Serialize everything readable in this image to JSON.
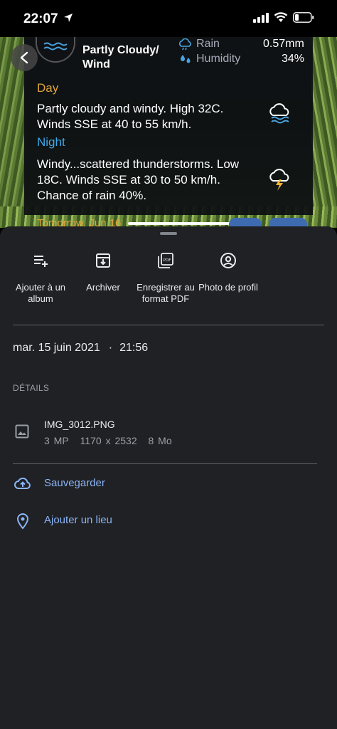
{
  "status_bar": {
    "time": "22:07"
  },
  "photo": {
    "condition": "Partly Cloudy/ Wind",
    "rain_label": "Rain",
    "rain_value": "0.57mm",
    "humidity_label": "Humidity",
    "humidity_value": "34%",
    "day_label": "Day",
    "day_text": "Partly cloudy and windy. High 32C. Winds SSE at 40 to 55 km/h.",
    "night_label": "Night",
    "night_text": "Windy...scattered thunderstorms. Low 18C. Winds SSE at 30 to 50 km/h. Chance of rain 40%.",
    "tomorrow_label": "Tomorrow, Jun 16"
  },
  "actions": [
    {
      "label": "Ajouter à un album",
      "icon": "playlist-add-icon"
    },
    {
      "label": "Archiver",
      "icon": "archive-icon"
    },
    {
      "label": "Enregistrer au format PDF",
      "icon": "pdf-icon"
    },
    {
      "label": "Photo de profil",
      "icon": "account-circle-icon"
    }
  ],
  "info": {
    "date": "mar. 15 juin 2021",
    "separator": "·",
    "time": "21:56",
    "details_header": "DÉTAILS",
    "file_name": "IMG_3012.PNG",
    "megapixels": "3 MP",
    "resolution": "1170 x 2532",
    "file_size": "8 Mo"
  },
  "links": {
    "backup": "Sauvegarder",
    "add_location": "Ajouter un lieu"
  },
  "colors": {
    "sheet_bg": "#202124",
    "link": "#8ab4f8",
    "day_accent": "#e0a53a",
    "night_accent": "#3fa8e6"
  }
}
